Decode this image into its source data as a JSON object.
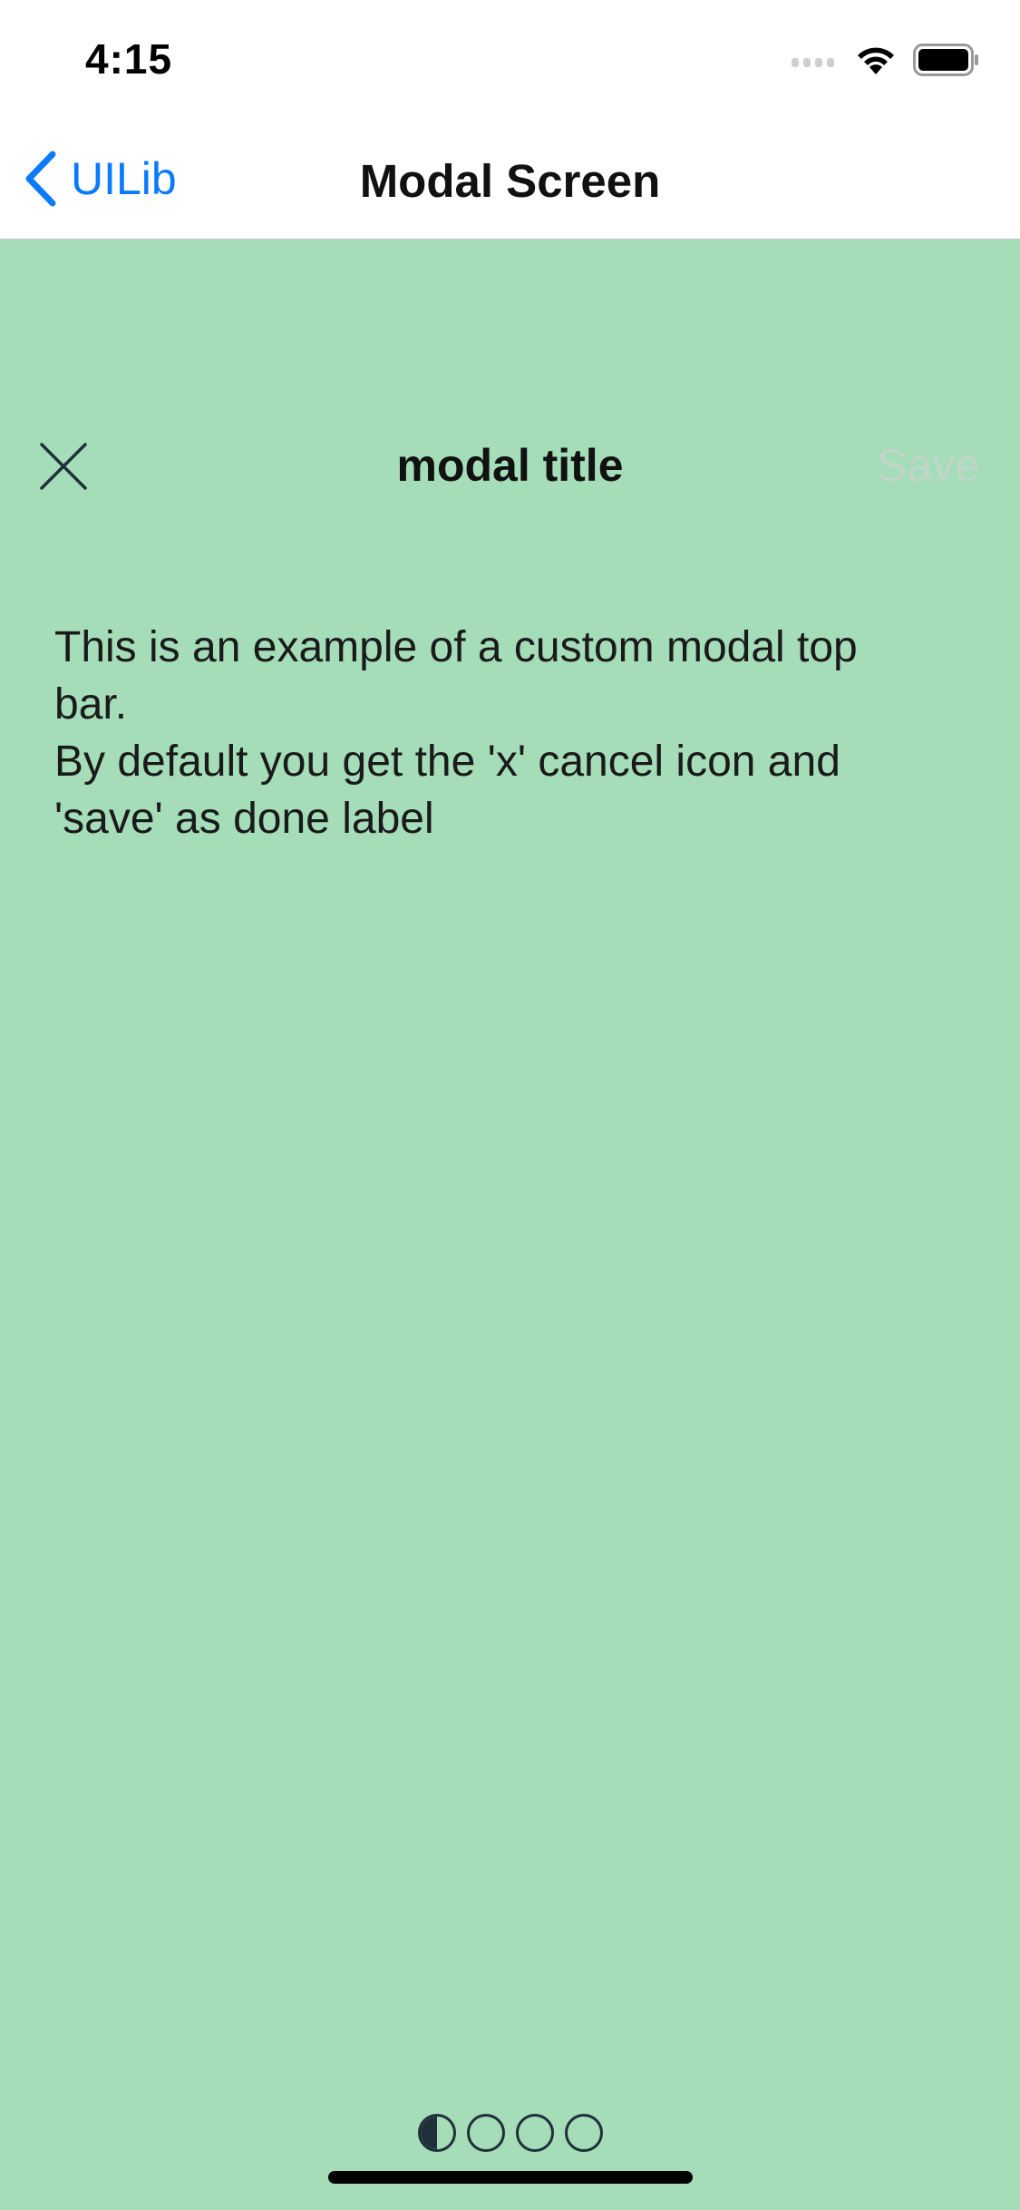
{
  "status_bar": {
    "time": "4:15",
    "icons": [
      "cellular-signal-icon",
      "wifi-icon",
      "battery-icon"
    ]
  },
  "nav": {
    "back_label": "UILib",
    "title": "Modal Screen",
    "accent_color": "#0a7aff"
  },
  "modal": {
    "title": "modal title",
    "save_label": "Save",
    "cancel_icon": "close-icon",
    "background_color": "#a5ddb9",
    "body_lines": [
      "This is an example of a custom modal top",
      "bar.",
      "By default you get the 'x' cancel icon and",
      "'save' as done label"
    ]
  },
  "page_indicator": {
    "count": 4,
    "active_index": 0
  }
}
